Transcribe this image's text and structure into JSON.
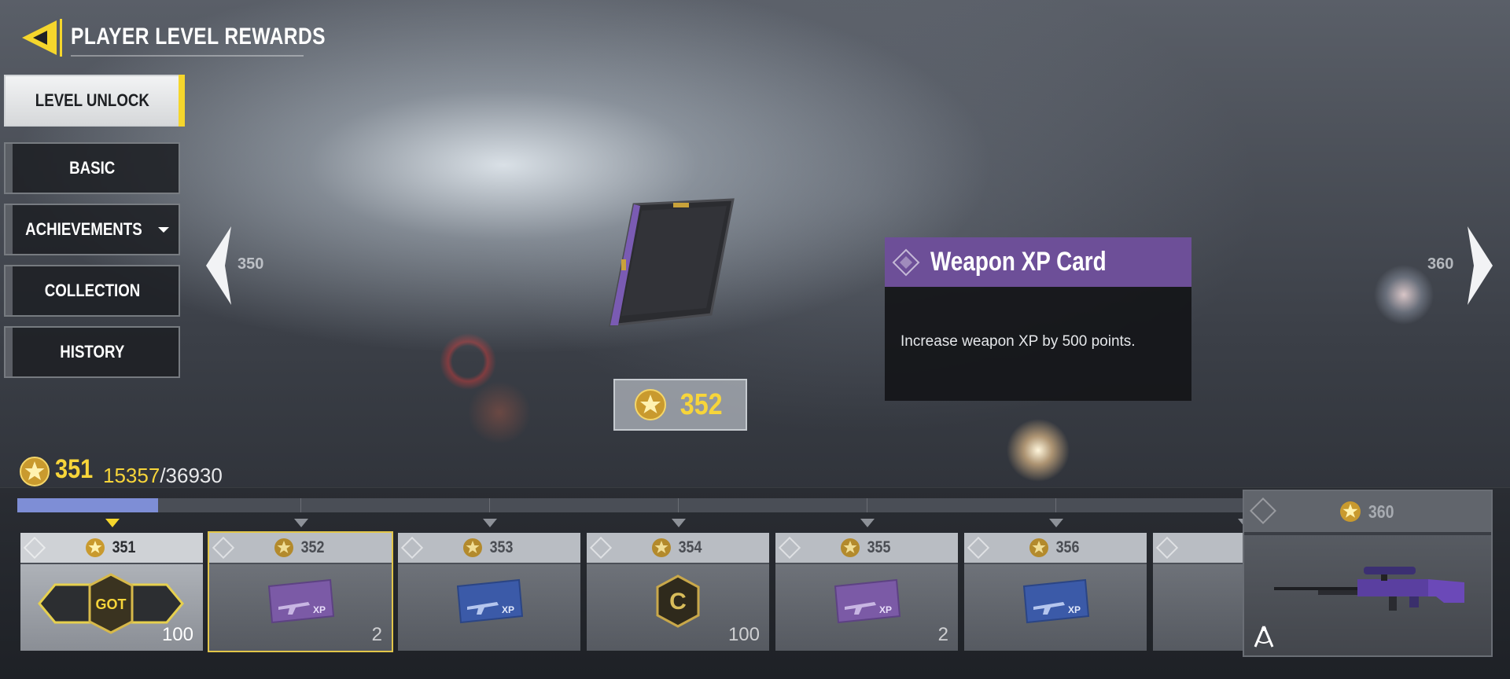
{
  "header": {
    "title": "PLAYER LEVEL REWARDS"
  },
  "nav": [
    {
      "label": "LEVEL UNLOCK",
      "active": true
    },
    {
      "label": "BASIC",
      "active": false
    },
    {
      "label": "ACHIEVEMENTS",
      "active": false,
      "has_dropdown": true
    },
    {
      "label": "COLLECTION",
      "active": false
    },
    {
      "label": "HISTORY",
      "active": false
    }
  ],
  "pager": {
    "prev_level": "350",
    "next_level": "360"
  },
  "featured": {
    "level": "352",
    "name": "Weapon XP Card",
    "description": "Increase weapon XP by 500 points."
  },
  "player": {
    "level": "351",
    "xp_current": "15357",
    "xp_total": "/36930",
    "progress_fraction": 0.115
  },
  "reward_track": [
    {
      "level": "351",
      "item": "cod-points-icon",
      "badge": "GOT",
      "qty": "100",
      "state": "claimed"
    },
    {
      "level": "352",
      "item": "purple-weapon-xp-card-icon",
      "qty": "2",
      "state": "selected"
    },
    {
      "level": "353",
      "item": "blue-weapon-xp-card-icon",
      "qty": "",
      "state": "locked"
    },
    {
      "level": "354",
      "item": "cod-points-icon",
      "qty": "100",
      "state": "locked"
    },
    {
      "level": "355",
      "item": "purple-weapon-xp-card-icon",
      "qty": "2",
      "state": "locked"
    },
    {
      "level": "356",
      "item": "blue-weapon-xp-card-icon",
      "qty": "",
      "state": "locked"
    }
  ],
  "milestone": {
    "level": "360",
    "item": "sniper-rifle-blueprint-icon"
  },
  "colors": {
    "accent_yellow": "#f5d62c",
    "rarity_purple": "#6d4f98",
    "progress_blue": "#7e8ed6"
  }
}
